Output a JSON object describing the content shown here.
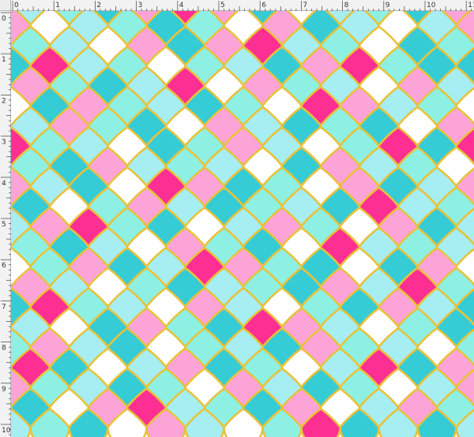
{
  "ruler": {
    "unit_marks_top": [
      "0",
      "1",
      "2",
      "3",
      "4",
      "5",
      "6",
      "7",
      "8",
      "9",
      "10",
      "11"
    ],
    "unit_marks_left": [
      "0",
      "1",
      "2",
      "3",
      "4",
      "5",
      "6",
      "7",
      "8",
      "9",
      "10"
    ]
  },
  "pattern": {
    "name": "mermaid-scales",
    "outline_color": "#e8c23a",
    "colors": {
      "P": "#fe2f93",
      "L": "#fca4d7",
      "T": "#36ccd6",
      "M": "#8ef0e2",
      "S": "#a6eef2",
      "W": "#ffffff"
    },
    "rows": [
      "SMTLPLTWSMTL",
      "LWSMTMWLTSWS",
      "MSWLTLPSMWTM",
      "TPSMWMSTLPMT",
      "LMTSPWLMSWLS",
      "WTLMSTMWPLSM",
      "SLMTWLSTMTWL",
      "PMSWTMLSWMPT",
      "MTLSMSWTLSMW",
      "LSTWPLTMWLTS",
      "TWMLSTMSTPSM",
      "SLPMTWSLMWLT",
      "MTSWLMTWPSMS",
      "WMLTSPLMTWTL",
      "LSWMTSMTLSPM",
      "TPMSWLSWMTLS",
      "SWTLMTPLSWMT",
      "MLSTWMSTLMSW",
      "PTWSLTMWSPTL",
      "LMSTMWLSTMWS",
      "TWLPSMTLWSLM",
      "SMTWLSWMPTST"
    ]
  }
}
